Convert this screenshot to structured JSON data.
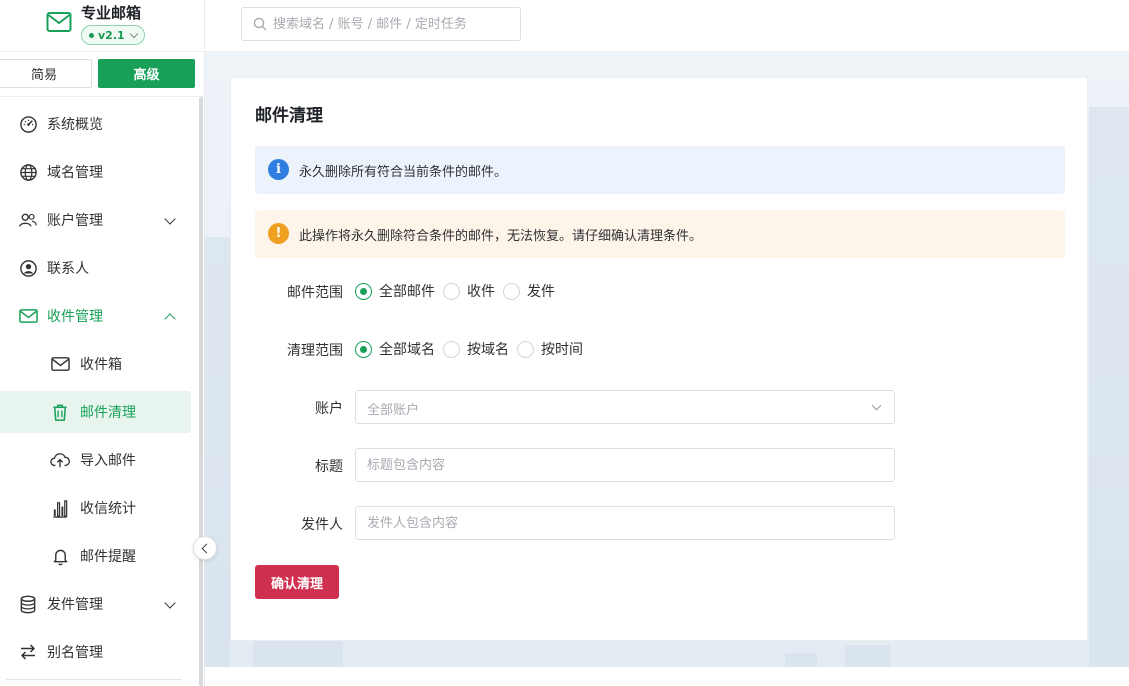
{
  "brand": {
    "title": "专业邮箱",
    "version": "v2.1"
  },
  "mode": {
    "simple": "简易",
    "advanced": "高级"
  },
  "sidebar": {
    "items": [
      {
        "label": "系统概览",
        "icon": "dashboard-icon"
      },
      {
        "label": "域名管理",
        "icon": "globe-icon"
      },
      {
        "label": "账户管理",
        "icon": "users-icon"
      },
      {
        "label": "联系人",
        "icon": "contact-icon"
      },
      {
        "label": "收件管理",
        "icon": "mail-icon"
      },
      {
        "label": "收件箱",
        "icon": "inbox-icon"
      },
      {
        "label": "邮件清理",
        "icon": "trash-icon"
      },
      {
        "label": "导入邮件",
        "icon": "cloud-upload-icon"
      },
      {
        "label": "收信统计",
        "icon": "bar-chart-icon"
      },
      {
        "label": "邮件提醒",
        "icon": "bell-icon"
      },
      {
        "label": "发件管理",
        "icon": "database-icon"
      },
      {
        "label": "别名管理",
        "icon": "swap-icon"
      }
    ]
  },
  "header": {
    "search_placeholder": "搜索域名 / 账号 / 邮件 / 定时任务"
  },
  "page": {
    "title": "邮件清理",
    "info_alert": "永久删除所有符合当前条件的邮件。",
    "warning_alert": "此操作将永久删除符合条件的邮件，无法恢复。请仔细确认清理条件。",
    "mail_scope": {
      "label": "邮件范围",
      "options": [
        "全部邮件",
        "收件",
        "发件"
      ]
    },
    "clean_scope": {
      "label": "清理范围",
      "options": [
        "全部域名",
        "按域名",
        "按时间"
      ]
    },
    "account": {
      "label": "账户",
      "placeholder": "全部账户"
    },
    "subject": {
      "label": "标题",
      "placeholder": "标题包含内容"
    },
    "sender": {
      "label": "发件人",
      "placeholder": "发件人包含内容"
    },
    "submit_label": "确认清理"
  },
  "colors": {
    "primary": "#18a058",
    "danger": "#d03050",
    "info": "#2f7de1",
    "warning": "#f0a020"
  }
}
